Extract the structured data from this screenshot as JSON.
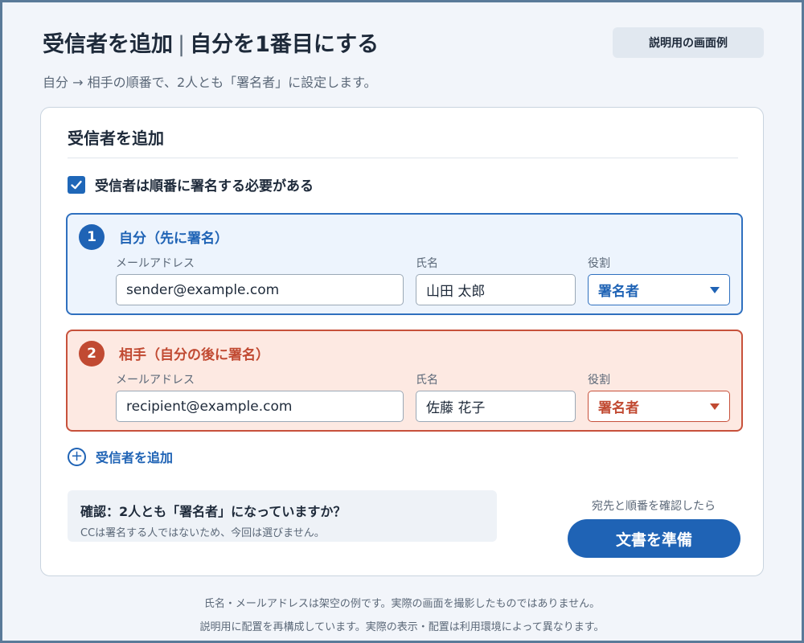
{
  "header": {
    "title_main": "受信者を追加",
    "title_separator": "|",
    "title_sub": "自分を1番目にする",
    "badge": "説明用の画面例",
    "subtitle": "自分 → 相手の順番で、2人とも「署名者」に設定します。"
  },
  "card": {
    "title": "受信者を追加",
    "order_checkbox": {
      "label": "受信者は順番に署名する必要がある",
      "checked": true
    },
    "recipients": [
      {
        "number": "1",
        "title": "自分（先に署名）",
        "email_label": "メールアドレス",
        "email_value": "sender@example.com",
        "name_label": "氏名",
        "name_value": "山田 太郎",
        "role_label": "役割",
        "role_value": "署名者"
      },
      {
        "number": "2",
        "title": "相手（自分の後に署名）",
        "email_label": "メールアドレス",
        "email_value": "recipient@example.com",
        "name_label": "氏名",
        "name_value": "佐藤 花子",
        "role_label": "役割",
        "role_value": "署名者"
      }
    ],
    "add_recipient": "受信者を追加",
    "confirm": {
      "title": "確認：2人とも「署名者」になっていますか？",
      "note": "CCは署名する人ではないため、今回は選びません。"
    },
    "prepare_hint": "宛先と順番を確認したら",
    "prepare_button": "文書を準備"
  },
  "footer": {
    "line1": "氏名・メールアドレスは架空の例です。実際の画面を撮影したものではありません。",
    "line2": "説明用に配置を再構成しています。実際の表示・配置は利用環境によって異なります。"
  },
  "colors": {
    "primary": "#1f63b5",
    "sender_bg": "#edf4fd",
    "recipient_accent": "#c14a32",
    "recipient_bg": "#fde9e2"
  },
  "icons": [
    "checkmark-icon",
    "plus-circle-icon",
    "caret-down-icon"
  ]
}
